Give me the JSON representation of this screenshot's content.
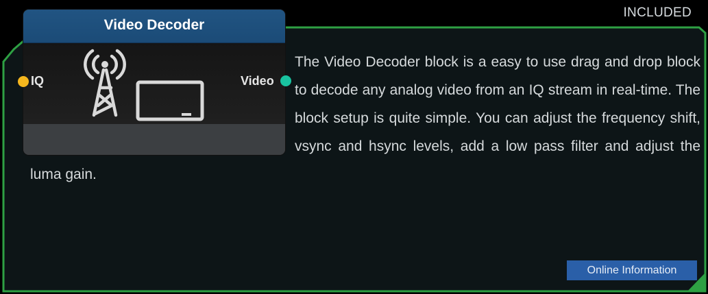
{
  "badge": "INCLUDED",
  "block": {
    "title": "Video Decoder",
    "input_port": "IQ",
    "output_port": "Video",
    "input_port_color": "#f6b71e",
    "output_port_color": "#19c3a0",
    "header_color": "#1f5080",
    "icons": [
      "radio-tower-icon",
      "television-icon"
    ]
  },
  "description": "The Video Decoder block is a easy to use drag and drop block to decode any analog video from an IQ stream in real-time. The block setup is quite simple. You can adjust the frequency shift, vsync and hsync levels, add a low pass filter and adjust the luma gain.",
  "actions": {
    "online_info": "Online Information"
  },
  "colors": {
    "panel_border": "#2ea043",
    "panel_background": "#0d1517",
    "accent_button": "#2a5fa8"
  }
}
